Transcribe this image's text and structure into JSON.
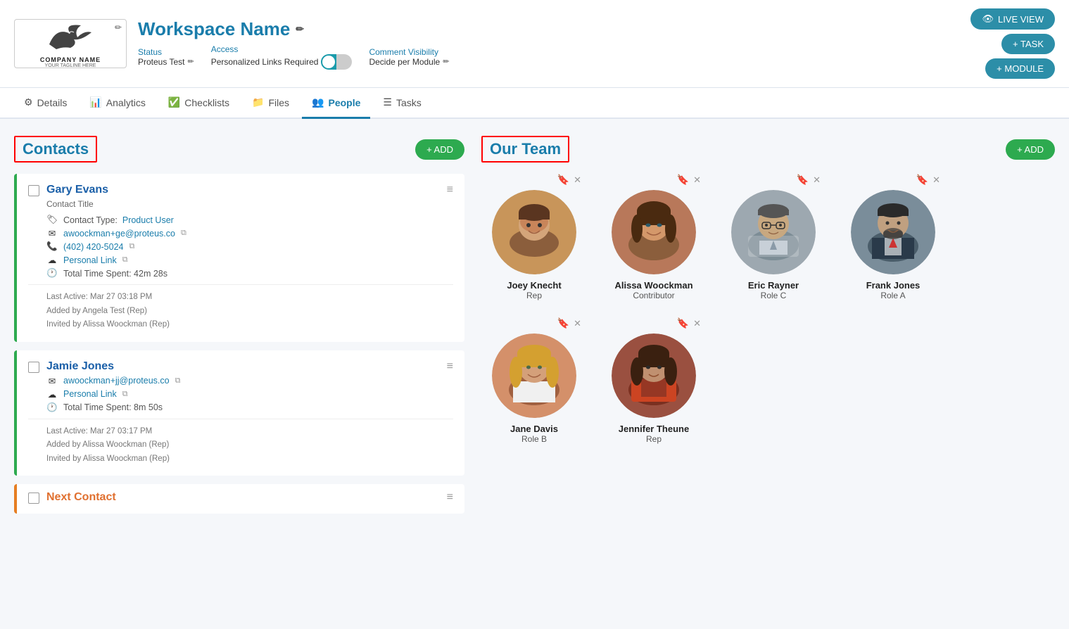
{
  "header": {
    "workspace_title": "Workspace Name",
    "edit_icon": "✏",
    "logo_company": "COMPANY NAME",
    "logo_tagline": "YOUR TAGLINE HERE",
    "status_label": "Status",
    "status_value": "Proteus Test",
    "access_label": "Access",
    "access_value": "Personalized Links Required",
    "comment_label": "Comment Visibility",
    "comment_value": "Decide per Module",
    "btn_live_view": "LIVE VIEW",
    "btn_add_task": "+ TASK",
    "btn_add_module": "+ MODULE"
  },
  "nav": {
    "tabs": [
      {
        "id": "details",
        "label": "Details",
        "icon": "⚙",
        "active": false
      },
      {
        "id": "analytics",
        "label": "Analytics",
        "icon": "📊",
        "active": false
      },
      {
        "id": "checklists",
        "label": "Checklists",
        "icon": "✅",
        "active": false
      },
      {
        "id": "files",
        "label": "Files",
        "icon": "📁",
        "active": false
      },
      {
        "id": "people",
        "label": "People",
        "icon": "👥",
        "active": true
      },
      {
        "id": "tasks",
        "label": "Tasks",
        "icon": "☰",
        "active": false
      }
    ]
  },
  "contacts": {
    "title": "Contacts",
    "btn_add": "+ ADD",
    "items": [
      {
        "id": "gary-evans",
        "name": "Gary Evans",
        "title": "Contact Title",
        "contact_type_label": "Contact Type:",
        "contact_type": "Product User",
        "email": "awoockman+ge@proteus.co",
        "phone": "(402) 420-5024",
        "personal_link": "Personal Link",
        "time_spent": "Total Time Spent: 42m 28s",
        "last_active": "Last Active: Mar 27 03:18 PM",
        "added_by": "Added by Angela Test (Rep)",
        "invited_by": "Invited by Alissa Woockman (Rep)",
        "border_color": "green"
      },
      {
        "id": "jamie-jones",
        "name": "Jamie Jones",
        "title": "",
        "email": "awoockman+jj@proteus.co",
        "personal_link": "Personal Link",
        "time_spent": "Total Time Spent: 8m 50s",
        "last_active": "Last Active: Mar 27 03:17 PM",
        "added_by": "Added by Alissa Woockman (Rep)",
        "invited_by": "Invited by Alissa Woockman (Rep)",
        "border_color": "green"
      },
      {
        "id": "next-contact",
        "name": "Next Contact",
        "border_color": "orange"
      }
    ]
  },
  "our_team": {
    "title": "Our Team",
    "btn_add": "+ ADD",
    "members": [
      {
        "id": "joey-knecht",
        "name": "Joey Knecht",
        "role": "Rep",
        "bookmarked": true,
        "row": 1
      },
      {
        "id": "alissa-woockman",
        "name": "Alissa Woockman",
        "role": "Contributor",
        "bookmarked": false,
        "row": 1
      },
      {
        "id": "eric-rayner",
        "name": "Eric Rayner",
        "role": "Role C",
        "bookmarked": false,
        "row": 1
      },
      {
        "id": "frank-jones",
        "name": "Frank Jones",
        "role": "Role A",
        "bookmarked": false,
        "row": 1
      },
      {
        "id": "jane-davis",
        "name": "Jane Davis",
        "role": "Role B",
        "bookmarked": false,
        "row": 2
      },
      {
        "id": "jennifer-theune",
        "name": "Jennifer Theune",
        "role": "Rep",
        "bookmarked": false,
        "row": 2
      }
    ]
  }
}
